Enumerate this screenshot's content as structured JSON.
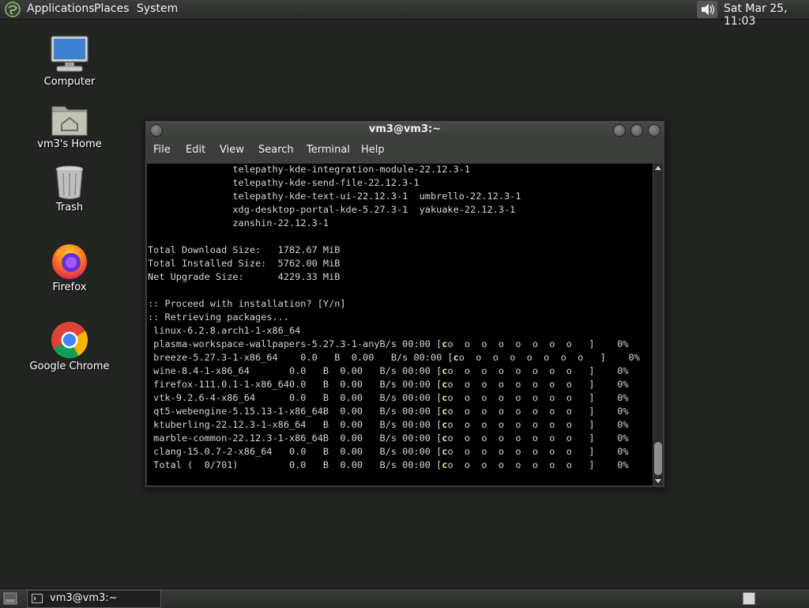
{
  "top_panel": {
    "menus": [
      "Applications",
      "Places",
      "System"
    ],
    "clock": "Sat Mar 25, 11:03",
    "icons": {
      "logo": "mate-logo-icon",
      "volume": "speaker-icon"
    }
  },
  "desktop": {
    "icons": [
      {
        "label": "Computer",
        "icon": "computer-icon"
      },
      {
        "label": "vm3's Home",
        "icon": "home-folder-icon"
      },
      {
        "label": "Trash",
        "icon": "trash-icon"
      },
      {
        "label": "Firefox",
        "icon": "firefox-icon"
      },
      {
        "label": "Google Chrome",
        "icon": "chrome-icon"
      }
    ]
  },
  "terminal": {
    "title": "vm3@vm3:~",
    "menu": [
      "File",
      "Edit",
      "View",
      "Search",
      "Terminal",
      "Help"
    ],
    "lines": [
      "               telepathy-kde-integration-module-22.12.3-1",
      "               telepathy-kde-send-file-22.12.3-1",
      "               telepathy-kde-text-ui-22.12.3-1  umbrello-22.12.3-1",
      "               xdg-desktop-portal-kde-5.27.3-1  yakuake-22.12.3-1",
      "               zanshin-22.12.3-1",
      "",
      "Total Download Size:   1782.67 MiB",
      "Total Installed Size:  5762.00 MiB",
      "Net Upgrade Size:      4229.33 MiB",
      "",
      ":: Proceed with installation? [Y/n]",
      ":: Retrieving packages...",
      " linux-6.2.8.arch1-1-x86_64"
    ],
    "downloads": [
      {
        "name": "plasma-workspace-wallpapers-5.27.3-1-anyB/s 00:00 [",
        "percent": "0%"
      },
      {
        "name": "breeze-5.27.3-1-x86_64    0.0   B  0.00   B/s 00:00 [",
        "percent": "0%"
      },
      {
        "name": "wine-8.4-1-x86_64       0.0   B  0.00   B/s 00:00 [",
        "percent": "0%"
      },
      {
        "name": "firefox-111.0.1-1-x86_640.0   B  0.00   B/s 00:00 [",
        "percent": "0%"
      },
      {
        "name": "vtk-9.2.6-4-x86_64      0.0   B  0.00   B/s 00:00 [",
        "percent": "0%"
      },
      {
        "name": "qt5-webengine-5.15.13-1-x86_64B  0.00   B/s 00:00 [",
        "percent": "0%"
      },
      {
        "name": "ktuberling-22.12.3-1-x86_64   B  0.00   B/s 00:00 [",
        "percent": "0%"
      },
      {
        "name": "marble-common-22.12.3-1-x86_64B  0.00   B/s 00:00 [",
        "percent": "0%"
      },
      {
        "name": "clang-15.0.7-2-x86_64   0.0   B  0.00   B/s 00:00 [",
        "percent": "0%"
      },
      {
        "name": "Total (  0/701)         0.0   B  0.00   B/s 00:00 [",
        "percent": "0%"
      }
    ],
    "progress_pacman": "c",
    "progress_dots": "o  o  o  o  o  o  o  o   ]"
  },
  "bottom_panel": {
    "task": "vm3@vm3:~",
    "icons": {
      "show_desktop": "show-desktop-icon",
      "task": "terminal-icon",
      "workspace": "workspace-switcher-icon"
    }
  },
  "colors": {
    "desktop_bg": "#222422",
    "panel_bg": "#2f312f",
    "terminal_bg": "#000000",
    "terminal_fg": "#d6d6d6",
    "progress_fg": "#f5e9a0"
  }
}
